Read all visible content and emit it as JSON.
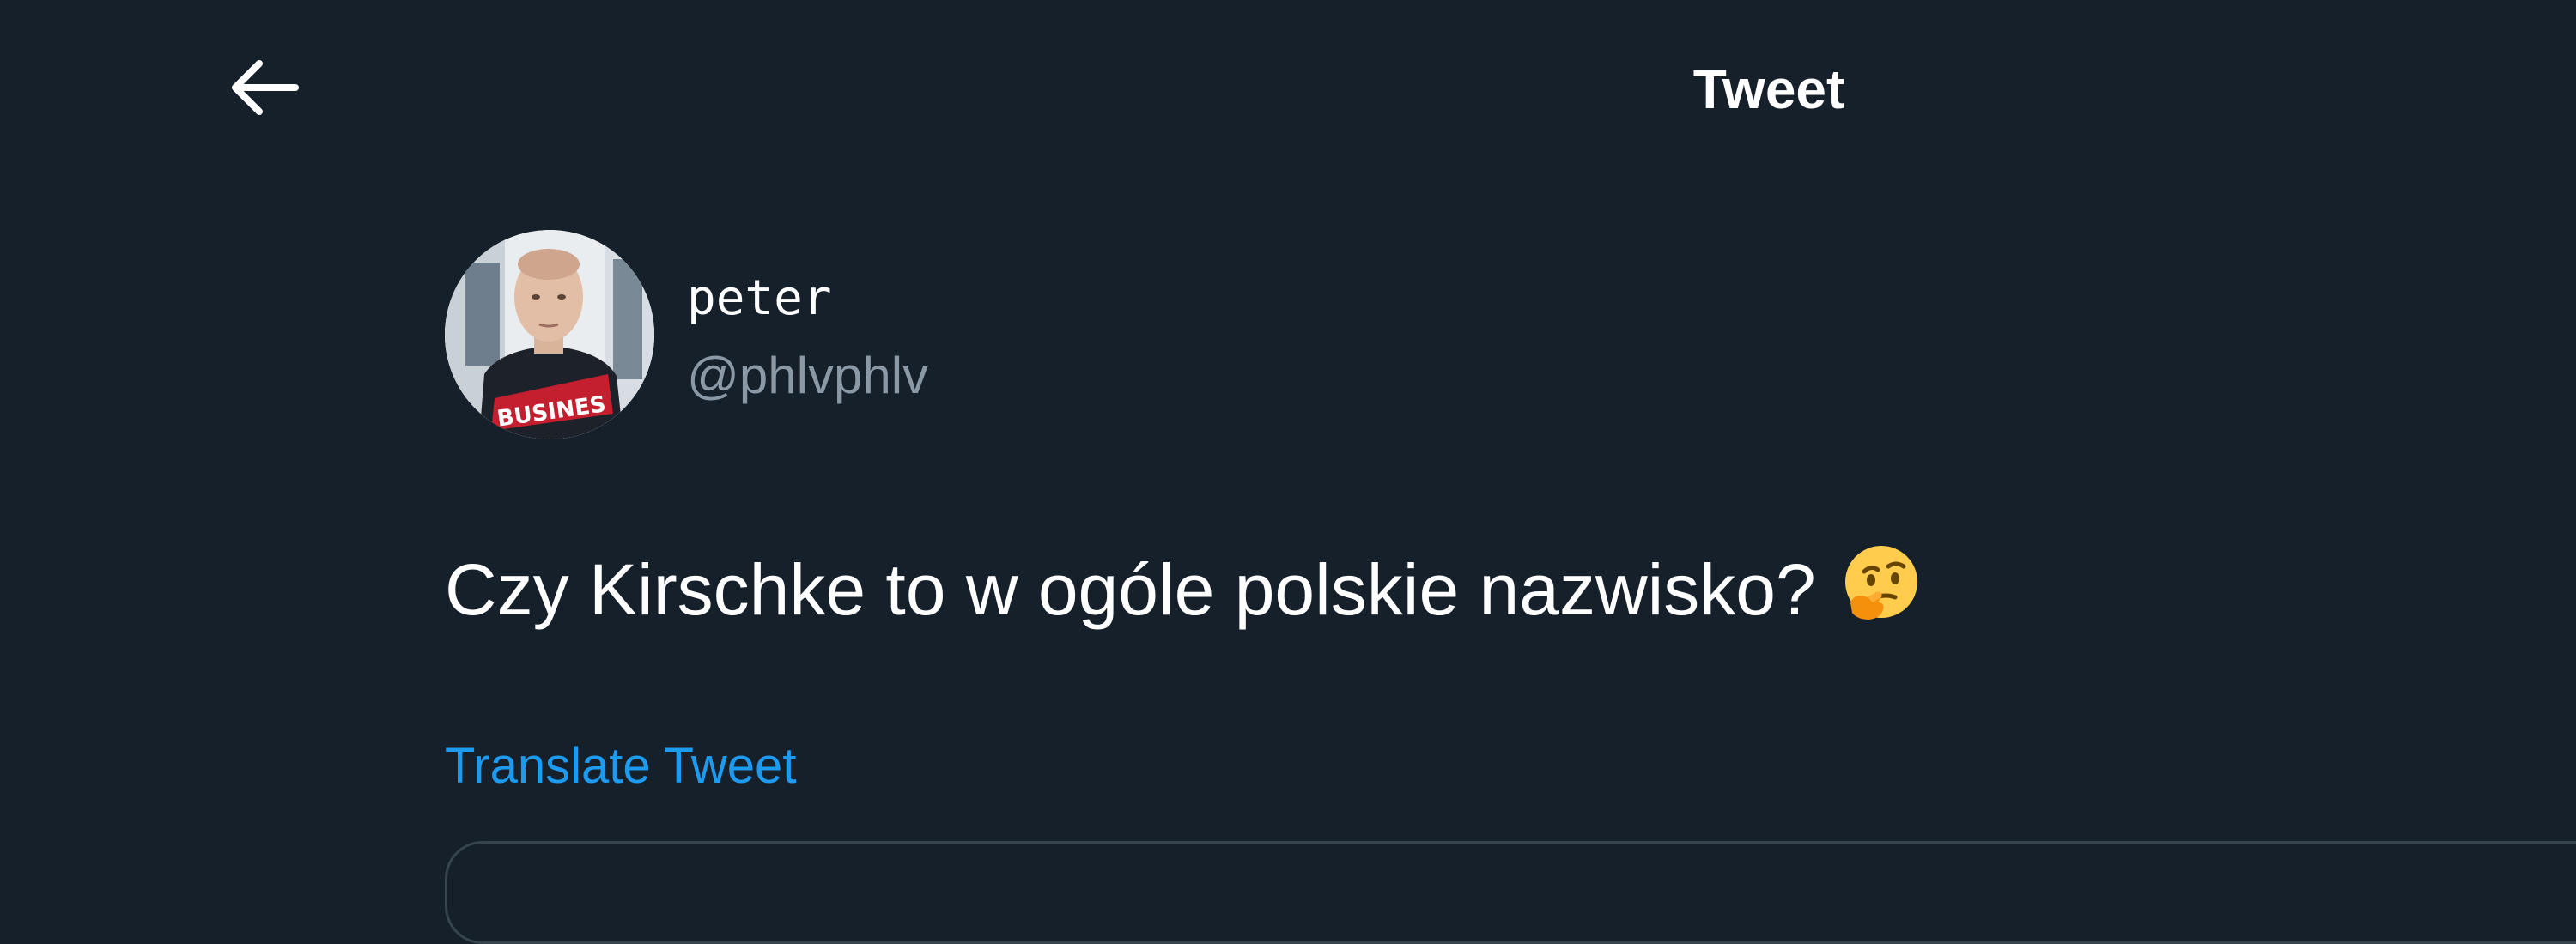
{
  "header": {
    "back_icon": "arrow-left-icon",
    "title": "Tweet"
  },
  "tweet": {
    "author": {
      "display_name": "peter",
      "handle": "@phlvphlv",
      "avatar_shirt_text": "BUSINES"
    },
    "text": "Czy Kirschke to w ogóle polskie nazwisko?",
    "emoji": "thinking-face-icon",
    "translate_label": "Translate Tweet"
  },
  "colors": {
    "background": "#16202b",
    "text_primary": "#ffffff",
    "text_secondary": "#8b98a5",
    "link": "#1d9bf0",
    "border": "#38444d"
  }
}
